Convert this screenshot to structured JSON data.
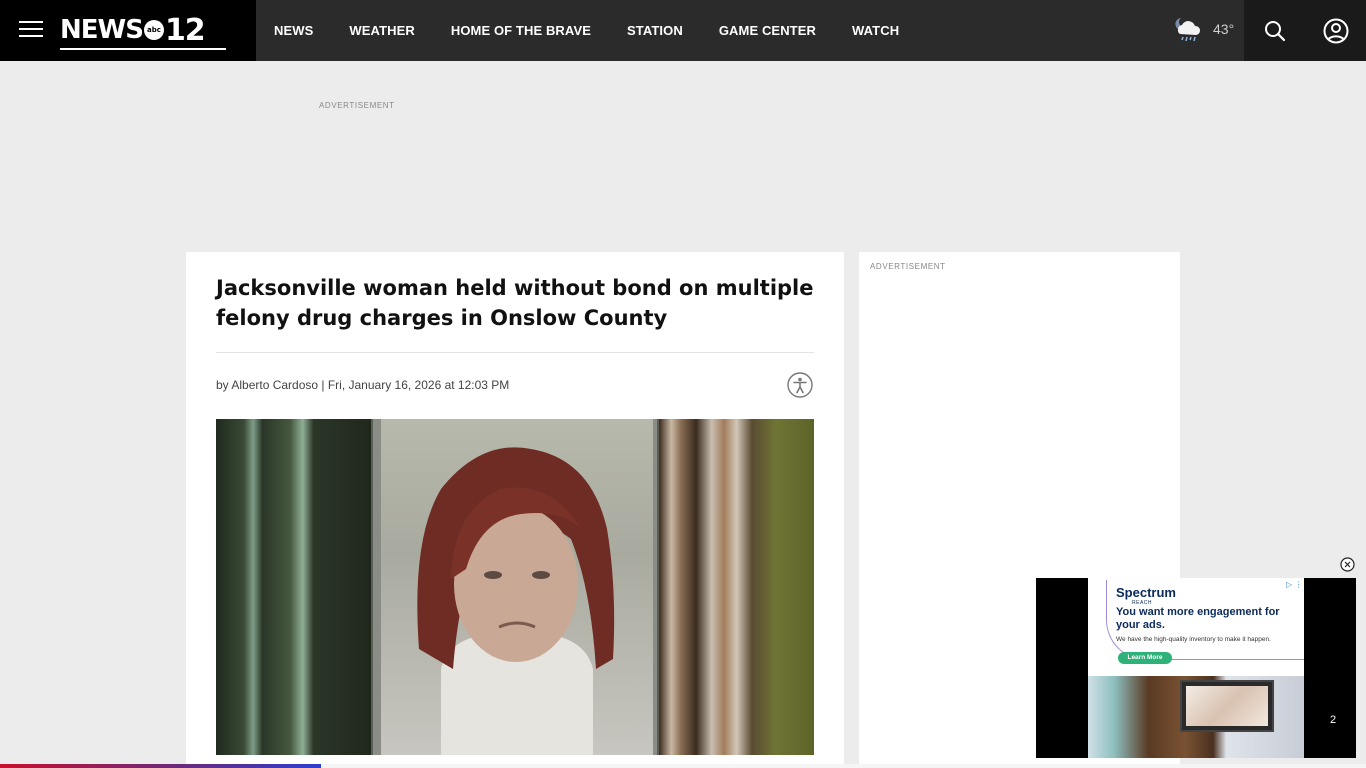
{
  "header": {
    "logo_text": "NEWS",
    "logo_badge": "abc",
    "logo_number": "12",
    "nav": [
      "NEWS",
      "WEATHER",
      "HOME OF THE BRAVE",
      "STATION",
      "GAME CENTER",
      "WATCH"
    ],
    "weather_temp": "43°",
    "weather_icon": "cloud-rain-moon-icon"
  },
  "ads": {
    "top_label": "ADVERTISEMENT",
    "sidebar_label": "ADVERTISEMENT"
  },
  "article": {
    "headline": "Jacksonville woman held without bond on multiple felony drug charges in Onslow County",
    "byline": "by Alberto Cardoso | Fri, January 16, 2026 at 12:03 PM"
  },
  "video_ad": {
    "brand": "Spectrum",
    "brand_sub": "REACH",
    "headline": "You want more engagement for your ads.",
    "subtext": "We have the high-quality inventory to make it happen.",
    "cta": "Learn More",
    "counter": "2"
  },
  "reading_progress": 0.235,
  "colors": {
    "header_bg": "#2b2b2b",
    "brand_bg": "#000000",
    "page_bg": "#ececec",
    "progress_start": "#c8102e",
    "progress_end": "#2d3fd1"
  }
}
